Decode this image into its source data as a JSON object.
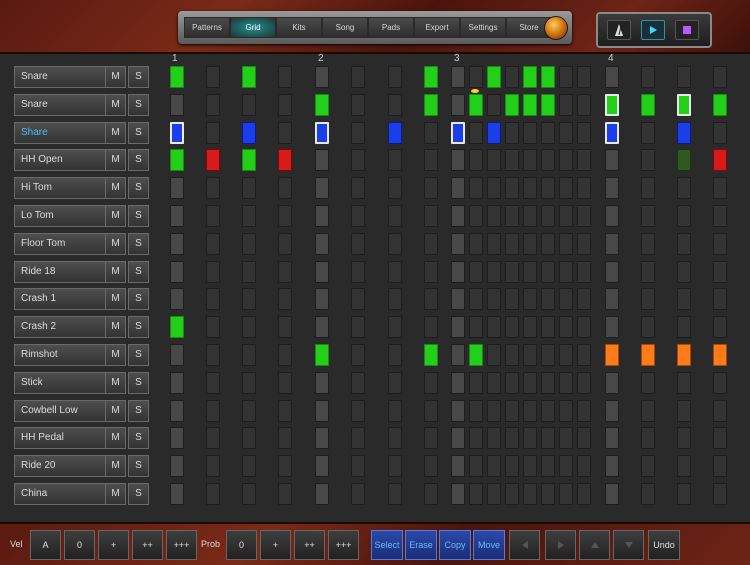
{
  "tabs": [
    "Patterns",
    "Grid",
    "Kits",
    "Song",
    "Pads",
    "Export",
    "Settings",
    "Store"
  ],
  "active_tab": "Grid",
  "transport": {
    "metronome_icon": "metronome-icon",
    "play_icon": "play-icon",
    "stop_icon": "stop-icon"
  },
  "beats": [
    "1",
    "2",
    "3",
    "4"
  ],
  "rows": [
    {
      "name": "Snare",
      "selected": false
    },
    {
      "name": "Snare",
      "selected": false
    },
    {
      "name": "Share",
      "selected": true
    },
    {
      "name": "HH Open",
      "selected": false
    },
    {
      "name": "Hi Tom",
      "selected": false
    },
    {
      "name": "Lo Tom",
      "selected": false
    },
    {
      "name": "Floor Tom",
      "selected": false
    },
    {
      "name": "Ride 18",
      "selected": false
    },
    {
      "name": "Crash 1",
      "selected": false
    },
    {
      "name": "Crash 2",
      "selected": false
    },
    {
      "name": "Rimshot",
      "selected": false
    },
    {
      "name": "Stick",
      "selected": false
    },
    {
      "name": "Cowbell Low",
      "selected": false
    },
    {
      "name": "HH Pedal",
      "selected": false
    },
    {
      "name": "Ride 20",
      "selected": false
    },
    {
      "name": "China",
      "selected": false
    }
  ],
  "mute_label": "M",
  "solo_label": "S",
  "grid": [
    {
      "notes": [
        [
          0,
          "green"
        ],
        [
          2,
          "green"
        ],
        [
          7,
          "green"
        ],
        [
          10,
          "green"
        ],
        [
          12,
          "green"
        ],
        [
          13,
          "green"
        ]
      ]
    },
    {
      "notes": [
        [
          4,
          "green"
        ],
        [
          7,
          "green"
        ],
        [
          9,
          "green"
        ],
        [
          11,
          "green"
        ],
        [
          12,
          "green"
        ],
        [
          13,
          "green"
        ],
        [
          14,
          "green-sel"
        ],
        [
          15,
          "green"
        ],
        [
          16,
          "green-sel"
        ],
        [
          17,
          "green"
        ]
      ]
    },
    {
      "notes": [
        [
          0,
          "blue-sel"
        ],
        [
          2,
          "blue"
        ],
        [
          4,
          "blue-sel"
        ],
        [
          6,
          "blue"
        ],
        [
          8,
          "blue-sel"
        ],
        [
          10,
          "blue"
        ],
        [
          14,
          "blue-sel"
        ],
        [
          16,
          "blue"
        ]
      ]
    },
    {
      "notes": [
        [
          0,
          "green"
        ],
        [
          1,
          "red"
        ],
        [
          2,
          "green"
        ],
        [
          3,
          "red"
        ],
        [
          16,
          "dkgreen"
        ],
        [
          17,
          "red"
        ]
      ]
    },
    {
      "notes": []
    },
    {
      "notes": []
    },
    {
      "notes": []
    },
    {
      "notes": []
    },
    {
      "notes": []
    },
    {
      "notes": [
        [
          0,
          "green"
        ]
      ]
    },
    {
      "notes": [
        [
          4,
          "green"
        ],
        [
          7,
          "green"
        ],
        [
          9,
          "green"
        ],
        [
          14,
          "orange"
        ],
        [
          15,
          "orange"
        ],
        [
          16,
          "orange"
        ],
        [
          17,
          "orange"
        ]
      ]
    },
    {
      "notes": []
    },
    {
      "notes": []
    },
    {
      "notes": []
    },
    {
      "notes": []
    },
    {
      "notes": []
    }
  ],
  "bottom": {
    "vel_label": "Vel",
    "vel_buttons": [
      "A",
      "0",
      "+",
      "++",
      "+++"
    ],
    "prob_label": "Prob",
    "prob_buttons": [
      "0",
      "+",
      "++",
      "+++"
    ],
    "edit_buttons": [
      "Select",
      "Erase",
      "Copy",
      "Move"
    ],
    "nav_icons": [
      "arrow-left-icon",
      "arrow-right-icon",
      "arrow-up-icon",
      "arrow-down-icon"
    ],
    "undo_label": "Undo"
  }
}
